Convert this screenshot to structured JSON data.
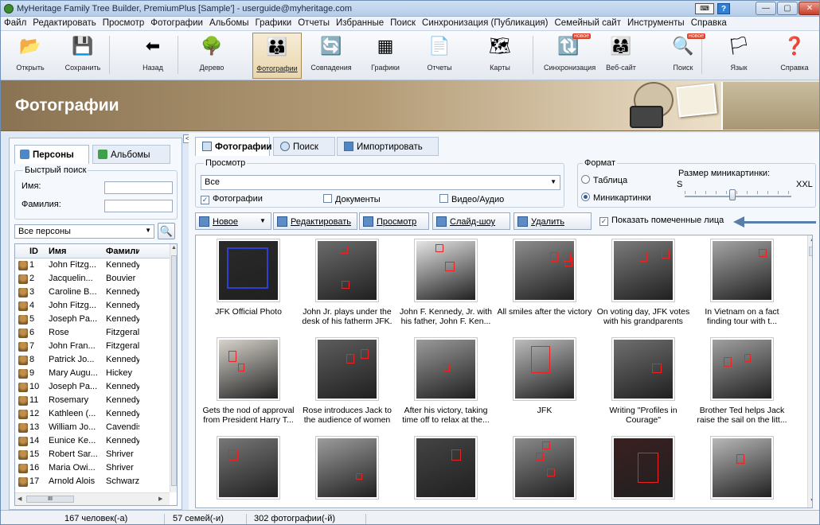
{
  "window": {
    "title": "MyHeritage Family Tree Builder, PremiumPlus [Sample'] - userguide@myheritage.com",
    "controls": {
      "minimize": "—",
      "maximize": "▢",
      "close": "✕"
    },
    "keyboard_icon": "keyboard-icon",
    "help_label": "?"
  },
  "menu": [
    "Файл",
    "Редактировать",
    "Просмотр",
    "Фотографии",
    "Альбомы",
    "Графики",
    "Отчеты",
    "Избранные",
    "Поиск",
    "Синхронизация (Публикация)",
    "Семейный сайт",
    "Инструменты",
    "Справка"
  ],
  "toolbar": {
    "badge": "новое",
    "buttons": [
      {
        "label": "Открыть",
        "icon": "folder-open-icon",
        "glyph": "📂"
      },
      {
        "label": "Сохранить",
        "icon": "save-icon",
        "glyph": "💾"
      },
      {
        "label": "Назад",
        "icon": "back-arrow-icon",
        "glyph": "⬅"
      },
      {
        "label": "Дерево",
        "icon": "tree-icon",
        "glyph": "🌳"
      },
      {
        "label": "Фотографии",
        "icon": "photos-icon",
        "glyph": "👪"
      },
      {
        "label": "Совпадения",
        "icon": "matches-icon",
        "glyph": "🔄"
      },
      {
        "label": "Графики",
        "icon": "charts-icon",
        "glyph": "▦"
      },
      {
        "label": "Отчеты",
        "icon": "reports-icon",
        "glyph": "📄"
      },
      {
        "label": "Карты",
        "icon": "maps-icon",
        "glyph": "🗺"
      },
      {
        "label": "Синхронизация",
        "icon": "sync-icon",
        "glyph": "🔃"
      },
      {
        "label": "Веб-сайт",
        "icon": "website-icon",
        "glyph": "👨‍👩‍👧"
      },
      {
        "label": "Поиск",
        "icon": "search-icon",
        "glyph": "🔍"
      },
      {
        "label": "Язык",
        "icon": "language-flag-icon",
        "glyph": "🏳"
      },
      {
        "label": "Справка",
        "icon": "help-icon",
        "glyph": "❓"
      }
    ]
  },
  "banner": {
    "title": "Фотографии"
  },
  "left_panel": {
    "collapse_label": "<",
    "tabs": {
      "persons": "Персоны",
      "albums": "Альбомы"
    },
    "quick_search": {
      "title": "Быстрый поиск",
      "name_label": "Имя:",
      "surname_label": "Фамилия:"
    },
    "filter": "Все персоны",
    "columns": {
      "id": "ID",
      "first": "Имя",
      "last": "Фамилия"
    },
    "persons": [
      {
        "id": "1",
        "first": "John Fitzg...",
        "last": "Kennedy"
      },
      {
        "id": "2",
        "first": "Jacquelin...",
        "last": "Bouvier"
      },
      {
        "id": "3",
        "first": "Caroline B...",
        "last": "Kennedy"
      },
      {
        "id": "4",
        "first": "John Fitzg...",
        "last": "Kennedy"
      },
      {
        "id": "5",
        "first": "Joseph Pa...",
        "last": "Kennedy"
      },
      {
        "id": "6",
        "first": "Rose",
        "last": "Fitzgerald"
      },
      {
        "id": "7",
        "first": "John Fran...",
        "last": "Fitzgerald"
      },
      {
        "id": "8",
        "first": "Patrick Jo...",
        "last": "Kennedy"
      },
      {
        "id": "9",
        "first": "Mary Augu...",
        "last": "Hickey"
      },
      {
        "id": "10",
        "first": "Joseph Pa...",
        "last": "Kennedy"
      },
      {
        "id": "11",
        "first": "Rosemary",
        "last": "Kennedy"
      },
      {
        "id": "12",
        "first": "Kathleen (...",
        "last": "Kennedy"
      },
      {
        "id": "13",
        "first": "William Jo...",
        "last": "Cavendish"
      },
      {
        "id": "14",
        "first": "Eunice Ke...",
        "last": "Kennedy"
      },
      {
        "id": "15",
        "first": "Robert Sar...",
        "last": "Shriver"
      },
      {
        "id": "16",
        "first": "Maria Owi...",
        "last": "Shriver"
      },
      {
        "id": "17",
        "first": "Arnold Alois",
        "last": "Schwarz..."
      }
    ],
    "hscroll_label": "III"
  },
  "main": {
    "tabs": {
      "photos": "Фотографии",
      "search": "Поиск",
      "import": "Импортировать"
    },
    "view": {
      "title": "Просмотр",
      "selected": "Все",
      "checkboxes": [
        {
          "label": "Фотографии",
          "checked": true
        },
        {
          "label": "Документы",
          "checked": false
        },
        {
          "label": "Видео/Аудио",
          "checked": false
        }
      ]
    },
    "format": {
      "title": "Формат",
      "table": "Таблица",
      "thumbnails": "Миникартинки",
      "size_label": "Размер миникартинки:",
      "size_min": "S",
      "size_max": "XXL",
      "size_level": 0.45
    },
    "actions": {
      "new": "Новое",
      "edit": "Редактировать",
      "view": "Просмотр",
      "slideshow": "Слайд-шоу",
      "delete": "Удалить",
      "show_faces": "Показать помеченные лица"
    },
    "photos": [
      {
        "caption": "JFK Official Photo",
        "bg": "#2a2a2a"
      },
      {
        "caption": "John Jr. plays under the desk of his fatherm JFK.",
        "bg": "#6b6b6b"
      },
      {
        "caption": "John F. Kennedy, Jr. with his father, John F. Ken...",
        "bg": "#e5e5e5"
      },
      {
        "caption": "All smiles after the victory",
        "bg": "#8d8d8d"
      },
      {
        "caption": "On voting day, JFK votes with his grandparents",
        "bg": "#7b7b7b"
      },
      {
        "caption": "In Vietnam on a fact finding tour with t...",
        "bg": "#a5a5a5"
      },
      {
        "caption": "Gets the nod of approval from President Harry T...",
        "bg": "#d8d4cc"
      },
      {
        "caption": "Rose introduces Jack to the audience of women",
        "bg": "#5d5d5d"
      },
      {
        "caption": "After his victory, taking time off to relax at the...",
        "bg": "#9a9a9a"
      },
      {
        "caption": "JFK",
        "bg": "#bcbcbc"
      },
      {
        "caption": "Writing \"Profiles in Courage\"",
        "bg": "#6f6f6f"
      },
      {
        "caption": "Brother Ted helps Jack raise the sail on the litt...",
        "bg": "#a0a0a0"
      },
      {
        "caption": "",
        "bg": "#777777"
      },
      {
        "caption": "",
        "bg": "#9c9c9c"
      },
      {
        "caption": "",
        "bg": "#444444"
      },
      {
        "caption": "",
        "bg": "#8a8a8a"
      },
      {
        "caption": "",
        "bg": "#3a2020"
      },
      {
        "caption": "",
        "bg": "#b8b8b8"
      }
    ]
  },
  "status": {
    "persons": "167 человек(-а)",
    "families": "57 семей(-и)",
    "photos": "302 фотографии(-й)"
  }
}
